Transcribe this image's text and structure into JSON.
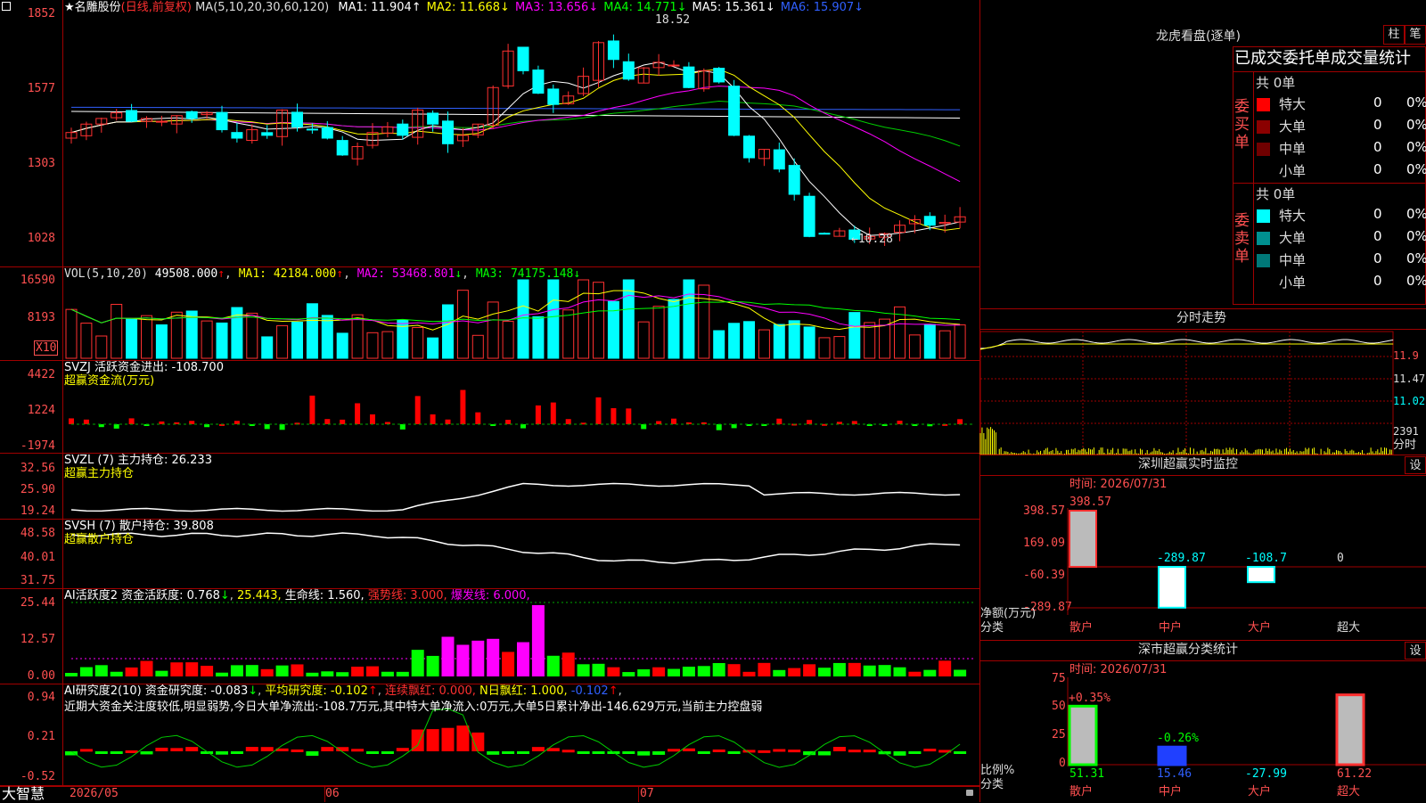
{
  "main": {
    "stock_name": "★名雕股份",
    "period": "(日线,前复权)",
    "ma_label": "MA(5,10,20,30,60,120)",
    "ma_values": [
      {
        "name": "MA1:",
        "value": "11.904",
        "color": "#ffffff"
      },
      {
        "name": "MA2:",
        "value": "11.668",
        "color": "#ffff00"
      },
      {
        "name": "MA3:",
        "value": "13.656",
        "color": "#ff00ff"
      },
      {
        "name": "MA4:",
        "value": "14.771",
        "color": "#00ff00"
      },
      {
        "name": "MA5:",
        "value": "15.361",
        "color": "#ffffff"
      },
      {
        "name": "MA6:",
        "value": "15.907",
        "color": "#3060ff"
      }
    ],
    "y_ticks": [
      "1852",
      "1577",
      "1303",
      "1028"
    ],
    "high_note": "18.52",
    "low_note": "←10.28"
  },
  "volume": {
    "label": "VOL(5,10,20)",
    "v0": "49508.000",
    "ma1": "MA1: 42184.000",
    "ma2": "MA2: 53468.801",
    "ma3": "MA3: 74175.148",
    "y_ticks": [
      "16590",
      "8193"
    ],
    "unit": "X10"
  },
  "svzj": {
    "label": "SVZJ  活跃资金进出: -108.700",
    "sub": "超赢资金流(万元)",
    "y_ticks": [
      "4422",
      "1224",
      "-1974"
    ]
  },
  "svzl": {
    "label": "SVZL (7) 主力持仓: 26.233",
    "sub": "超赢主力持仓",
    "y_ticks": [
      "32.56",
      "25.90",
      "19.24"
    ]
  },
  "svsh": {
    "label": "SVSH (7) 散户持仓: 39.808",
    "sub": "超赢散户持仓",
    "y_ticks": [
      "48.58",
      "40.01",
      "31.75"
    ]
  },
  "ai1": {
    "label": "AI活跃度2 资金活跃度: 0.768",
    "v2": "25.443,",
    "v3": "生命线: 1.560,",
    "v4": "强势线: 3.000,",
    "v5": "爆发线: 6.000,",
    "y_ticks": [
      "25.44",
      "12.57",
      "0.00"
    ]
  },
  "ai2": {
    "label": "AI研究度2(10) 资金研究度: -0.083",
    "v2": "平均研究度: -0.102",
    "v3": "连续飘红: 0.000,",
    "v4": "N日飘红: 1.000,",
    "v5": "-0.102",
    "comment": "近期大资金关注度较低,明显弱势,今日大单净流出:-108.7万元,其中特大单净流入:0万元,大单5日累计净出-146.629万元,当前主力控盘弱",
    "y_ticks": [
      "0.94",
      "0.21",
      "-0.52"
    ]
  },
  "bottom": {
    "brand": "大智慧",
    "dates": [
      "2026/05",
      "06",
      "07"
    ]
  },
  "right": {
    "lhb_title": "龙虎看盘(逐单)",
    "btn1": "柱",
    "btn2": "笔",
    "tabs_text": "已成交委托单成交量统计",
    "buy": {
      "side_label": "委买单",
      "total": "共 0单",
      "rows": [
        {
          "name": "特大",
          "count": "0",
          "pct": "0%",
          "color": "#ff0000"
        },
        {
          "name": "大单",
          "count": "0",
          "pct": "0%",
          "color": "#8b0000"
        },
        {
          "name": "中单",
          "count": "0",
          "pct": "0%",
          "color": "#700000"
        },
        {
          "name": "小单",
          "count": "0",
          "pct": "0%",
          "color": "#000000"
        }
      ]
    },
    "sell": {
      "side_label": "委卖单",
      "total": "共 0单",
      "rows": [
        {
          "name": "特大",
          "count": "0",
          "pct": "0%",
          "color": "#00ffff"
        },
        {
          "name": "大单",
          "count": "0",
          "pct": "0%",
          "color": "#009090"
        },
        {
          "name": "中单",
          "count": "0",
          "pct": "0%",
          "color": "#007878"
        },
        {
          "name": "小单",
          "count": "0",
          "pct": "0%",
          "color": "#000000"
        }
      ]
    },
    "fenshi": {
      "title": "分时走势",
      "ticks": [
        "11.9",
        "11.47",
        "11.02",
        "2391"
      ],
      "unit": "分时"
    },
    "monitor": {
      "title": "深圳超赢实时监控",
      "btn": "设",
      "time": "时间: 2026/07/31",
      "y_ticks": [
        "398.57",
        "169.09",
        "-60.39",
        "-289.87"
      ],
      "ylabel1": "净额(万元)",
      "ylabel2": "分类",
      "categories": [
        "散户",
        "中户",
        "大户",
        "超大"
      ],
      "values": [
        398.57,
        -289.87,
        -108.7,
        0
      ],
      "value_labels": [
        "398.57",
        "-289.87",
        "-108.7",
        "0"
      ]
    },
    "classify": {
      "title": "深市超赢分类统计",
      "btn": "设",
      "time": "时间: 2026/07/31",
      "y_ticks": [
        "75",
        "50",
        "25",
        "0"
      ],
      "ylabel1": "比例%",
      "ylabel2": "分类",
      "categories": [
        "散户",
        "中户",
        "大户",
        "超大"
      ],
      "top_labels": [
        "+0.35%",
        "-0.26%",
        "",
        ""
      ],
      "values": [
        51.31,
        15.46,
        -27.99,
        61.22
      ],
      "value_labels": [
        "51.31",
        "15.46",
        "-27.99",
        "61.22"
      ]
    }
  }
}
